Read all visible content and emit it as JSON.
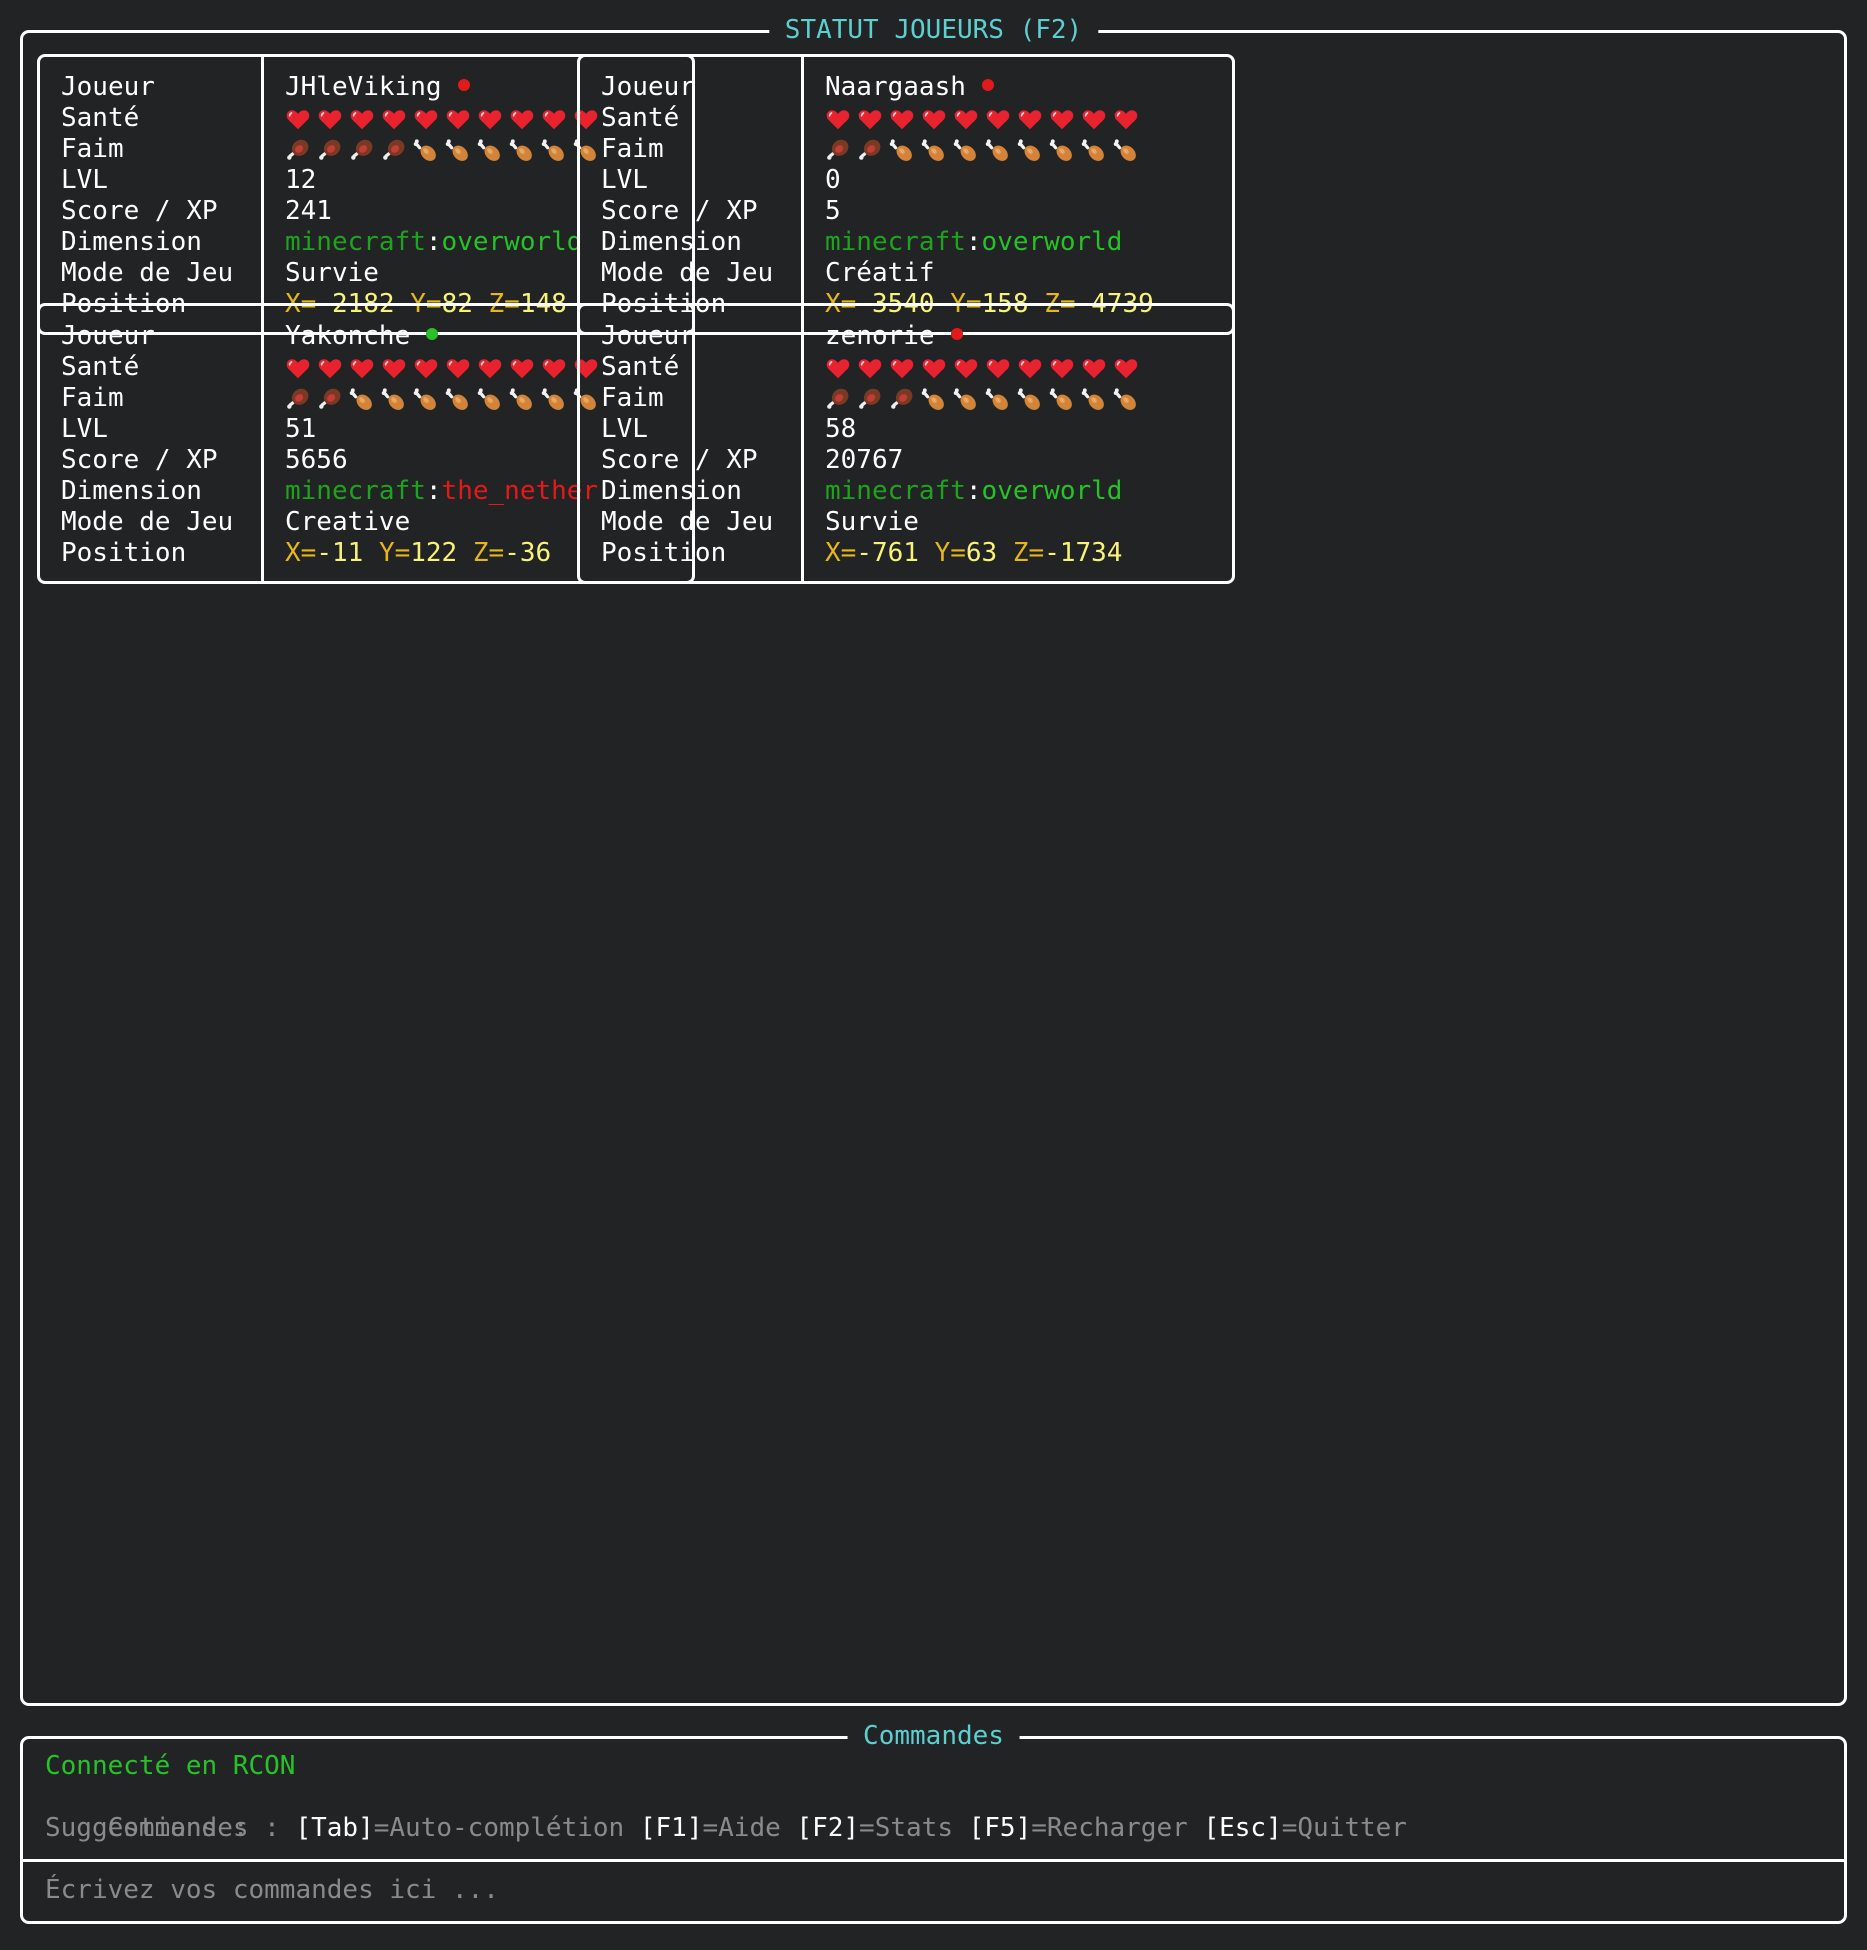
{
  "status_panel": {
    "title": "STATUT JOUEURS (F2)"
  },
  "field_labels": [
    "Joueur",
    "Santé",
    "Faim",
    "LVL",
    "Score / XP",
    "Dimension",
    "Mode de Jeu",
    "Position"
  ],
  "status_colors": {
    "online": "#27c227",
    "offline": "#e21a1a"
  },
  "players": [
    {
      "name": "JHleViking",
      "status": "offline",
      "health_hearts": 10,
      "food_full": 4,
      "food_total": 10,
      "level": "12",
      "score": "241",
      "dimension_ns": "minecraft",
      "dimension_sep": ":",
      "dimension_name": "overworld",
      "dimension_type": "overworld",
      "gamemode": "Survie",
      "pos": {
        "xk": "X=",
        "xv": "-2182",
        "yk": "Y=",
        "yv": "82",
        "zk": "Z=",
        "zv": "148"
      }
    },
    {
      "name": "Naargaash",
      "status": "offline",
      "health_hearts": 10,
      "food_full": 2,
      "food_total": 10,
      "level": "0",
      "score": "5",
      "dimension_ns": "minecraft",
      "dimension_sep": ":",
      "dimension_name": "overworld",
      "dimension_type": "overworld",
      "gamemode": "Créatif",
      "pos": {
        "xk": "X=",
        "xv": "-3540",
        "yk": "Y=",
        "yv": "158",
        "zk": "Z=",
        "zv": "-4739"
      }
    },
    {
      "name": "Yakonche",
      "status": "online",
      "health_hearts": 10,
      "food_full": 2,
      "food_total": 10,
      "level": "51",
      "score": "5656",
      "dimension_ns": "minecraft",
      "dimension_sep": ":",
      "dimension_name": "the_nether",
      "dimension_type": "nether",
      "gamemode": "Creative",
      "pos": {
        "xk": "X=",
        "xv": "-11",
        "yk": "Y=",
        "yv": "122",
        "zk": "Z=",
        "zv": "-36"
      }
    },
    {
      "name": "zenorie",
      "status": "offline",
      "health_hearts": 10,
      "food_full": 3,
      "food_total": 10,
      "level": "58",
      "score": "20767",
      "dimension_ns": "minecraft",
      "dimension_sep": ":",
      "dimension_name": "overworld",
      "dimension_type": "overworld",
      "gamemode": "Survie",
      "pos": {
        "xk": "X=",
        "xv": "-761",
        "yk": "Y=",
        "yv": "63",
        "zk": "Z=",
        "zv": "-1734"
      }
    }
  ],
  "icons": {
    "health": "heart-icon",
    "food_full": "meat-icon",
    "food_empty": "drumstick-icon"
  },
  "commands_panel": {
    "title": "Commandes",
    "connection": "Connecté en RCON",
    "hint_label": "Commandes : ",
    "hints": [
      {
        "key": "[Tab]",
        "desc": "=Auto-complétion"
      },
      {
        "key": "[F1]",
        "desc": "=Aide"
      },
      {
        "key": "[F2]",
        "desc": "=Stats"
      },
      {
        "key": "[F5]",
        "desc": "=Recharger"
      },
      {
        "key": "[Esc]",
        "desc": "=Quitter"
      }
    ],
    "suggestions_label": "Suggestions :",
    "input_placeholder": "Écrivez vos commandes ici ..."
  }
}
